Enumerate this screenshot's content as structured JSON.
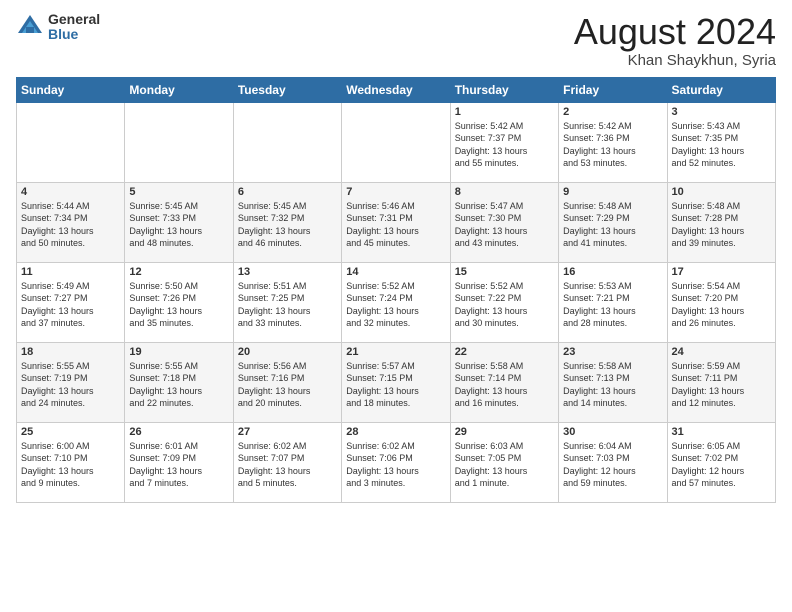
{
  "header": {
    "logo_general": "General",
    "logo_blue": "Blue",
    "month_title": "August 2024",
    "location": "Khan Shaykhun, Syria"
  },
  "days_of_week": [
    "Sunday",
    "Monday",
    "Tuesday",
    "Wednesday",
    "Thursday",
    "Friday",
    "Saturday"
  ],
  "weeks": [
    [
      {
        "day": "",
        "detail": ""
      },
      {
        "day": "",
        "detail": ""
      },
      {
        "day": "",
        "detail": ""
      },
      {
        "day": "",
        "detail": ""
      },
      {
        "day": "1",
        "detail": "Sunrise: 5:42 AM\nSunset: 7:37 PM\nDaylight: 13 hours\nand 55 minutes."
      },
      {
        "day": "2",
        "detail": "Sunrise: 5:42 AM\nSunset: 7:36 PM\nDaylight: 13 hours\nand 53 minutes."
      },
      {
        "day": "3",
        "detail": "Sunrise: 5:43 AM\nSunset: 7:35 PM\nDaylight: 13 hours\nand 52 minutes."
      }
    ],
    [
      {
        "day": "4",
        "detail": "Sunrise: 5:44 AM\nSunset: 7:34 PM\nDaylight: 13 hours\nand 50 minutes."
      },
      {
        "day": "5",
        "detail": "Sunrise: 5:45 AM\nSunset: 7:33 PM\nDaylight: 13 hours\nand 48 minutes."
      },
      {
        "day": "6",
        "detail": "Sunrise: 5:45 AM\nSunset: 7:32 PM\nDaylight: 13 hours\nand 46 minutes."
      },
      {
        "day": "7",
        "detail": "Sunrise: 5:46 AM\nSunset: 7:31 PM\nDaylight: 13 hours\nand 45 minutes."
      },
      {
        "day": "8",
        "detail": "Sunrise: 5:47 AM\nSunset: 7:30 PM\nDaylight: 13 hours\nand 43 minutes."
      },
      {
        "day": "9",
        "detail": "Sunrise: 5:48 AM\nSunset: 7:29 PM\nDaylight: 13 hours\nand 41 minutes."
      },
      {
        "day": "10",
        "detail": "Sunrise: 5:48 AM\nSunset: 7:28 PM\nDaylight: 13 hours\nand 39 minutes."
      }
    ],
    [
      {
        "day": "11",
        "detail": "Sunrise: 5:49 AM\nSunset: 7:27 PM\nDaylight: 13 hours\nand 37 minutes."
      },
      {
        "day": "12",
        "detail": "Sunrise: 5:50 AM\nSunset: 7:26 PM\nDaylight: 13 hours\nand 35 minutes."
      },
      {
        "day": "13",
        "detail": "Sunrise: 5:51 AM\nSunset: 7:25 PM\nDaylight: 13 hours\nand 33 minutes."
      },
      {
        "day": "14",
        "detail": "Sunrise: 5:52 AM\nSunset: 7:24 PM\nDaylight: 13 hours\nand 32 minutes."
      },
      {
        "day": "15",
        "detail": "Sunrise: 5:52 AM\nSunset: 7:22 PM\nDaylight: 13 hours\nand 30 minutes."
      },
      {
        "day": "16",
        "detail": "Sunrise: 5:53 AM\nSunset: 7:21 PM\nDaylight: 13 hours\nand 28 minutes."
      },
      {
        "day": "17",
        "detail": "Sunrise: 5:54 AM\nSunset: 7:20 PM\nDaylight: 13 hours\nand 26 minutes."
      }
    ],
    [
      {
        "day": "18",
        "detail": "Sunrise: 5:55 AM\nSunset: 7:19 PM\nDaylight: 13 hours\nand 24 minutes."
      },
      {
        "day": "19",
        "detail": "Sunrise: 5:55 AM\nSunset: 7:18 PM\nDaylight: 13 hours\nand 22 minutes."
      },
      {
        "day": "20",
        "detail": "Sunrise: 5:56 AM\nSunset: 7:16 PM\nDaylight: 13 hours\nand 20 minutes."
      },
      {
        "day": "21",
        "detail": "Sunrise: 5:57 AM\nSunset: 7:15 PM\nDaylight: 13 hours\nand 18 minutes."
      },
      {
        "day": "22",
        "detail": "Sunrise: 5:58 AM\nSunset: 7:14 PM\nDaylight: 13 hours\nand 16 minutes."
      },
      {
        "day": "23",
        "detail": "Sunrise: 5:58 AM\nSunset: 7:13 PM\nDaylight: 13 hours\nand 14 minutes."
      },
      {
        "day": "24",
        "detail": "Sunrise: 5:59 AM\nSunset: 7:11 PM\nDaylight: 13 hours\nand 12 minutes."
      }
    ],
    [
      {
        "day": "25",
        "detail": "Sunrise: 6:00 AM\nSunset: 7:10 PM\nDaylight: 13 hours\nand 9 minutes."
      },
      {
        "day": "26",
        "detail": "Sunrise: 6:01 AM\nSunset: 7:09 PM\nDaylight: 13 hours\nand 7 minutes."
      },
      {
        "day": "27",
        "detail": "Sunrise: 6:02 AM\nSunset: 7:07 PM\nDaylight: 13 hours\nand 5 minutes."
      },
      {
        "day": "28",
        "detail": "Sunrise: 6:02 AM\nSunset: 7:06 PM\nDaylight: 13 hours\nand 3 minutes."
      },
      {
        "day": "29",
        "detail": "Sunrise: 6:03 AM\nSunset: 7:05 PM\nDaylight: 13 hours\nand 1 minute."
      },
      {
        "day": "30",
        "detail": "Sunrise: 6:04 AM\nSunset: 7:03 PM\nDaylight: 12 hours\nand 59 minutes."
      },
      {
        "day": "31",
        "detail": "Sunrise: 6:05 AM\nSunset: 7:02 PM\nDaylight: 12 hours\nand 57 minutes."
      }
    ]
  ]
}
